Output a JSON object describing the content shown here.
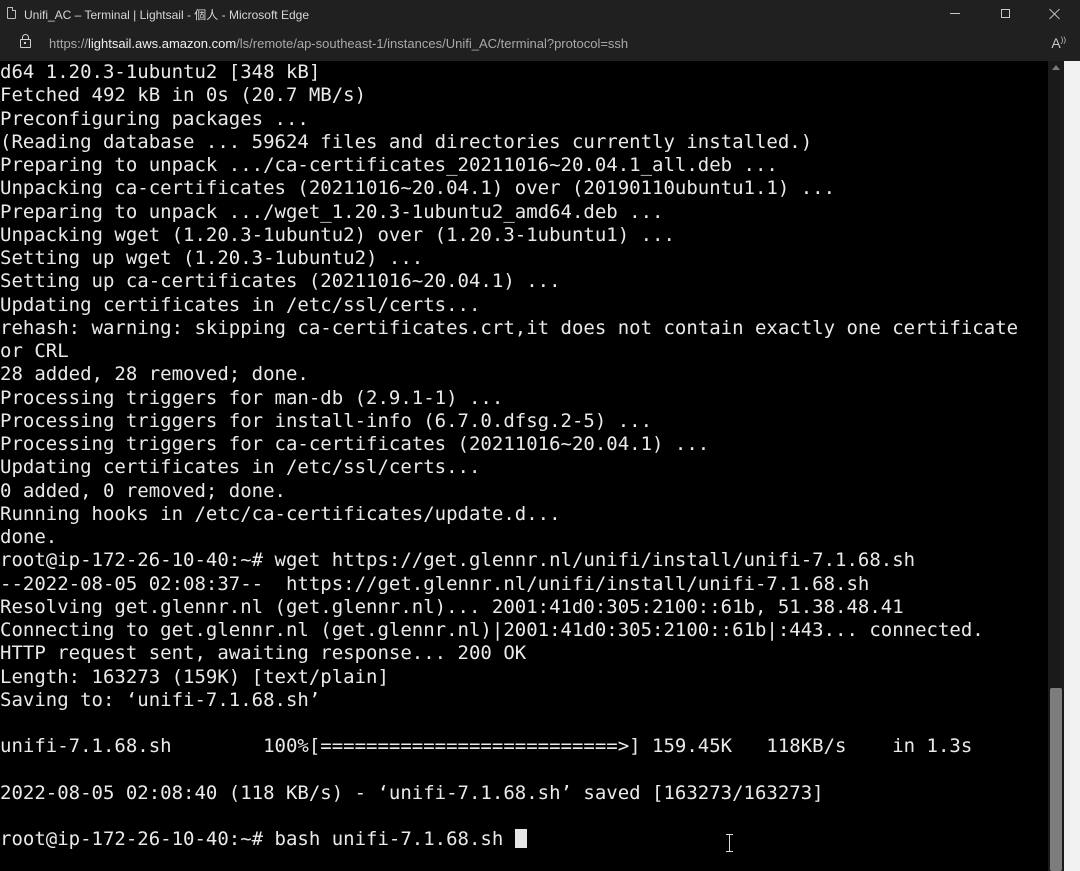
{
  "window": {
    "title": "Unifi_AC – Terminal | Lightsail - 個人 - Microsoft Edge"
  },
  "addressbar": {
    "url_prefix": "https://",
    "url_host": "lightsail.aws.amazon.com",
    "url_path": "/ls/remote/ap-southeast-1/instances/Unifi_AC/terminal?protocol=ssh",
    "read_aloud_label": "A"
  },
  "terminal": {
    "lines": [
      "d64 1.20.3-1ubuntu2 [348 kB]",
      "Fetched 492 kB in 0s (20.7 MB/s)",
      "Preconfiguring packages ...",
      "(Reading database ... 59624 files and directories currently installed.)",
      "Preparing to unpack .../ca-certificates_20211016~20.04.1_all.deb ...",
      "Unpacking ca-certificates (20211016~20.04.1) over (20190110ubuntu1.1) ...",
      "Preparing to unpack .../wget_1.20.3-1ubuntu2_amd64.deb ...",
      "Unpacking wget (1.20.3-1ubuntu2) over (1.20.3-1ubuntu1) ...",
      "Setting up wget (1.20.3-1ubuntu2) ...",
      "Setting up ca-certificates (20211016~20.04.1) ...",
      "Updating certificates in /etc/ssl/certs...",
      "rehash: warning: skipping ca-certificates.crt,it does not contain exactly one certificate",
      "or CRL",
      "28 added, 28 removed; done.",
      "Processing triggers for man-db (2.9.1-1) ...",
      "Processing triggers for install-info (6.7.0.dfsg.2-5) ...",
      "Processing triggers for ca-certificates (20211016~20.04.1) ...",
      "Updating certificates in /etc/ssl/certs...",
      "0 added, 0 removed; done.",
      "Running hooks in /etc/ca-certificates/update.d...",
      "done.",
      "root@ip-172-26-10-40:~# wget https://get.glennr.nl/unifi/install/unifi-7.1.68.sh",
      "--2022-08-05 02:08:37--  https://get.glennr.nl/unifi/install/unifi-7.1.68.sh",
      "Resolving get.glennr.nl (get.glennr.nl)... 2001:41d0:305:2100::61b, 51.38.48.41",
      "Connecting to get.glennr.nl (get.glennr.nl)|2001:41d0:305:2100::61b|:443... connected.",
      "HTTP request sent, awaiting response... 200 OK",
      "Length: 163273 (159K) [text/plain]",
      "Saving to: ‘unifi-7.1.68.sh’",
      "",
      "unifi-7.1.68.sh        100%[==========================>] 159.45K   118KB/s    in 1.3s",
      "",
      "2022-08-05 02:08:40 (118 KB/s) - ‘unifi-7.1.68.sh’ saved [163273/163273]",
      ""
    ],
    "prompt_line": "root@ip-172-26-10-40:~# bash unifi-7.1.68.sh "
  }
}
